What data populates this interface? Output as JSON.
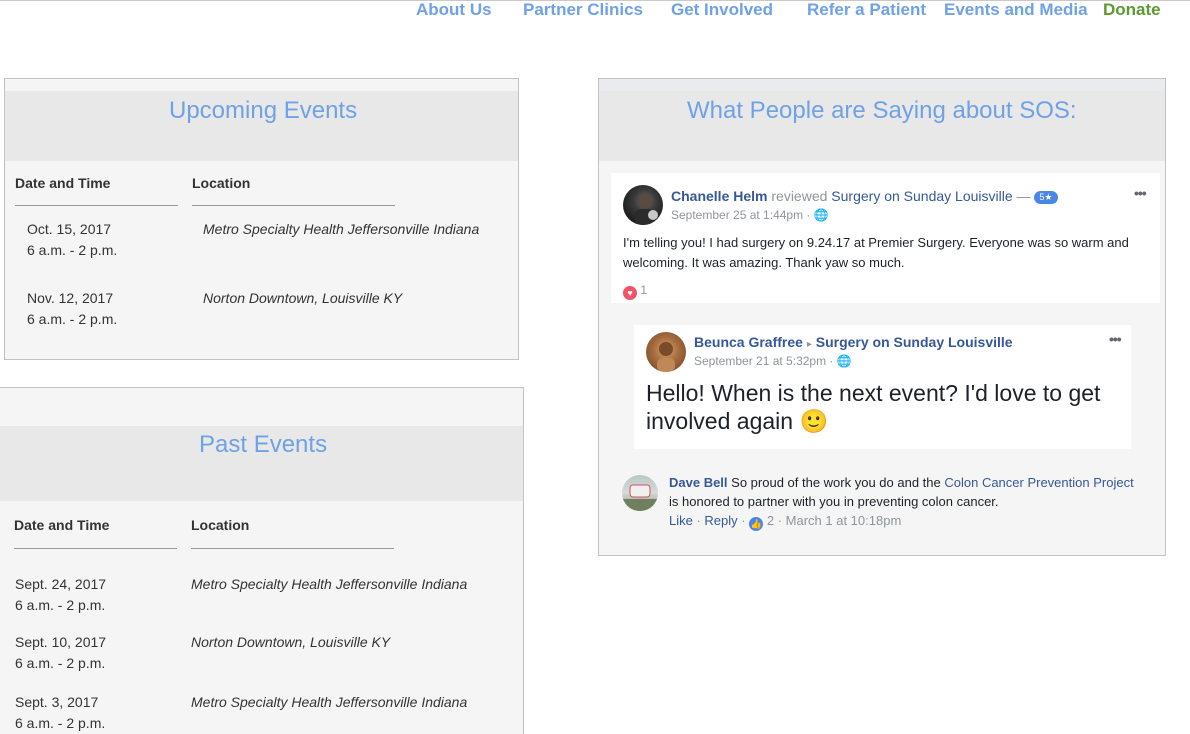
{
  "nav": {
    "about": "About Us",
    "partner": "Partner Clinics",
    "involved": "Get Involved",
    "refer": "Refer a Patient",
    "events": "Events and Media",
    "donate": "Donate"
  },
  "upcoming": {
    "title": "Upcoming Events",
    "col_date": "Date and Time",
    "col_location": "Location",
    "rows": [
      {
        "date": "Oct. 15, 2017",
        "time": "6 a.m. - 2 p.m.",
        "location": "Metro Specialty Health Jeffersonville Indiana"
      },
      {
        "date": "Nov. 12, 2017",
        "time": "6 a.m. - 2 p.m.",
        "location": "Norton Downtown, Louisville KY"
      }
    ]
  },
  "past": {
    "title": "Past Events",
    "col_date": "Date and Time",
    "col_location": "Location",
    "rows": [
      {
        "date": "Sept. 24, 2017",
        "time": "6 a.m. - 2 p.m.",
        "location": "Metro Specialty Health Jeffersonville Indiana"
      },
      {
        "date": "Sept. 10, 2017",
        "time": "6 a.m. - 2 p.m.",
        "location": "Norton Downtown, Louisville KY"
      },
      {
        "date": "Sept. 3, 2017",
        "time": "6 a.m. - 2 p.m.",
        "location": "Metro Specialty Health Jeffersonville Indiana"
      }
    ]
  },
  "testimonials": {
    "title": "What People are Saying about SOS:",
    "review": {
      "author": "Chanelle Helm",
      "action": "reviewed",
      "page": "Surgery on Sunday Louisville",
      "dash": "—",
      "rating": "5★",
      "time": "September 25 at 1:44pm · ",
      "text": "I'm telling you! I had surgery on 9.24.17 at Premier Surgery. Everyone was so warm and welcoming. It was amazing. Thank yaw so much.",
      "reactions": "1"
    },
    "post": {
      "author": "Beunca Graffree",
      "arrow": "▸",
      "page": "Surgery on Sunday Louisville",
      "time": "September 21 at 5:32pm · ",
      "text": "Hello! When is the next event? I'd love to get involved again",
      "emoji": "🙂"
    },
    "comment": {
      "author": "Dave Bell",
      "text_before": " So proud of the work you do and the ",
      "link": "Colon Cancer Prevention Project",
      "text_after": " is honored to partner with you in preventing colon cancer.",
      "like": "Like",
      "reply": "Reply",
      "likes": "2",
      "time": "March 1 at 10:18pm",
      "sep": " · "
    }
  },
  "colors": {
    "nav_link": "#6fa1e6",
    "donate": "#5a9a2e",
    "panel_bg": "#f5f5f5",
    "header_bg": "#e8e8e8",
    "fb_blue": "#365899"
  }
}
